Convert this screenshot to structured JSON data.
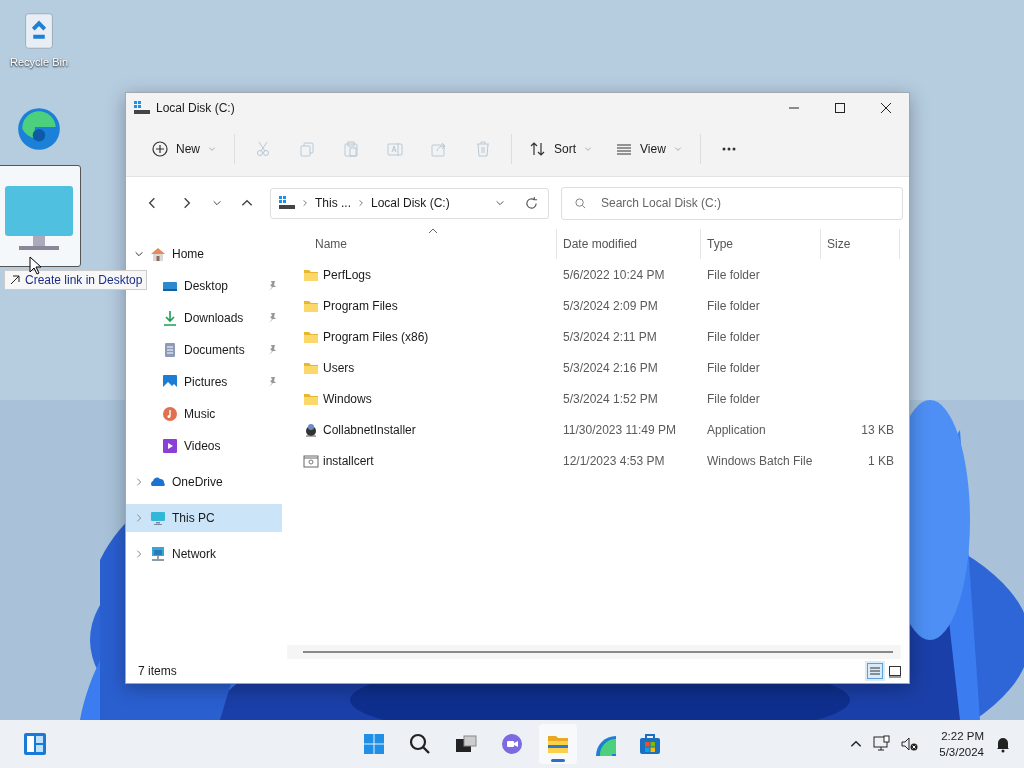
{
  "desktop_icons": [
    {
      "kind": "recycle",
      "label": "Recycle Bin"
    },
    {
      "kind": "edge"
    }
  ],
  "drag": {
    "tooltip": "Create link in Desktop"
  },
  "window": {
    "title": "Local Disk (C:)",
    "toolbar": [
      {
        "kind": "new",
        "label": "New",
        "disabled": false
      },
      {
        "kind": "separator"
      },
      {
        "kind": "cut",
        "disabled": true
      },
      {
        "kind": "copy",
        "disabled": true
      },
      {
        "kind": "paste",
        "disabled": true
      },
      {
        "kind": "rename",
        "disabled": true
      },
      {
        "kind": "share",
        "disabled": true
      },
      {
        "kind": "delete",
        "disabled": true
      },
      {
        "kind": "separator"
      },
      {
        "kind": "sort",
        "label": "Sort",
        "disabled": false
      },
      {
        "kind": "view",
        "label": "View",
        "disabled": false
      },
      {
        "kind": "separator"
      },
      {
        "kind": "more",
        "disabled": false
      }
    ],
    "address": {
      "crumbs": [
        "This ...",
        "Local Disk (C:)"
      ]
    },
    "search": {
      "placeholder": "Search Local Disk (C:)"
    },
    "sidebar": {
      "items": [
        {
          "kind": "home",
          "label": "Home",
          "expanded": true,
          "selected": false,
          "children": [
            {
              "kind": "desktop",
              "label": "Desktop",
              "pinned": true,
              "selected": false
            },
            {
              "kind": "downloads",
              "label": "Downloads",
              "pinned": true,
              "selected": false
            },
            {
              "kind": "documents",
              "label": "Documents",
              "pinned": true,
              "selected": false
            },
            {
              "kind": "pictures",
              "label": "Pictures",
              "pinned": true,
              "selected": false
            },
            {
              "kind": "music",
              "label": "Music",
              "pinned": false,
              "selected": false
            },
            {
              "kind": "videos",
              "label": "Videos",
              "pinned": false,
              "selected": false
            }
          ]
        },
        {
          "kind": "onedrive",
          "label": "OneDrive",
          "expanded": false,
          "selected": false
        },
        {
          "kind": "thispc",
          "label": "This PC",
          "expanded": false,
          "selected": true
        },
        {
          "kind": "network",
          "label": "Network",
          "expanded": false,
          "selected": false
        }
      ]
    },
    "table": {
      "columns": [
        "Name",
        "Date modified",
        "Type",
        "Size"
      ],
      "rows": [
        {
          "kind": "folder",
          "name": "PerfLogs",
          "date": "5/6/2022 10:24 PM",
          "type": "File folder",
          "selected": false
        },
        {
          "kind": "folder",
          "name": "Program Files",
          "date": "5/3/2024 2:09 PM",
          "type": "File folder",
          "selected": false
        },
        {
          "kind": "folder",
          "name": "Program Files (x86)",
          "date": "5/3/2024 2:11 PM",
          "type": "File folder",
          "selected": false
        },
        {
          "kind": "folder",
          "name": "Users",
          "date": "5/3/2024 2:16 PM",
          "type": "File folder",
          "selected": false
        },
        {
          "kind": "folder",
          "name": "Windows",
          "date": "5/3/2024 1:52 PM",
          "type": "File folder",
          "selected": false
        },
        {
          "kind": "app",
          "name": "CollabnetInstaller",
          "date": "11/30/2023 11:49 PM",
          "type": "Application",
          "size": "13 KB",
          "selected": false
        },
        {
          "kind": "batch",
          "name": "installcert",
          "date": "12/1/2023 4:53 PM",
          "type": "Windows Batch File",
          "size": "1 KB",
          "selected": false
        }
      ]
    },
    "status_bar": {
      "count": "7 items",
      "views": [
        {
          "kind": "details",
          "selected": true
        },
        {
          "kind": "tiles",
          "selected": false
        }
      ]
    }
  },
  "taskbar": {
    "apps": [
      {
        "kind": "start",
        "selected": false
      },
      {
        "kind": "search",
        "selected": false
      },
      {
        "kind": "taskview",
        "selected": false
      },
      {
        "kind": "chat",
        "selected": false
      },
      {
        "kind": "explorer",
        "selected": true
      },
      {
        "kind": "edge",
        "selected": false
      },
      {
        "kind": "store",
        "selected": false
      }
    ],
    "time": "2:22 PM",
    "date": "5/3/2024"
  }
}
